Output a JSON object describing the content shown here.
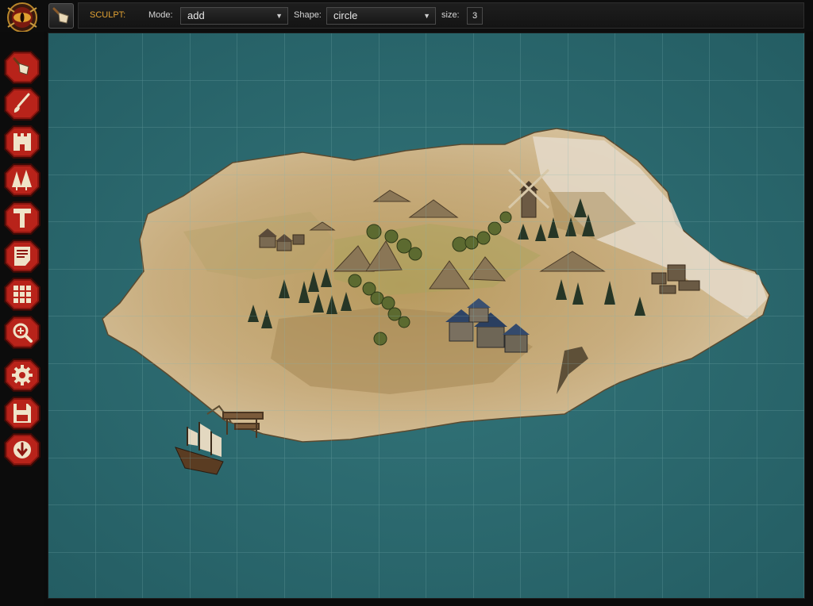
{
  "toolbar": {
    "active_tool_icon": "trowel-icon",
    "title": "SCULPT:",
    "mode_label": "Mode:",
    "mode_value": "add",
    "shape_label": "Shape:",
    "shape_value": "circle",
    "size_label": "size:",
    "size_value": "3"
  },
  "sidebar": {
    "tools": [
      {
        "name": "sculpt-tool",
        "icon": "trowel-icon"
      },
      {
        "name": "paint-tool",
        "icon": "brush-icon"
      },
      {
        "name": "buildings-tool",
        "icon": "castle-icon"
      },
      {
        "name": "trees-tool",
        "icon": "pine-trees-icon"
      },
      {
        "name": "text-tool",
        "icon": "letter-t-icon"
      },
      {
        "name": "notes-tool",
        "icon": "note-icon"
      },
      {
        "name": "grid-tool",
        "icon": "grid-icon"
      },
      {
        "name": "zoom-tool",
        "icon": "magnifier-icon"
      },
      {
        "name": "settings-tool",
        "icon": "gear-icon"
      },
      {
        "name": "save-tool",
        "icon": "floppy-disk-icon"
      },
      {
        "name": "download-tool",
        "icon": "download-icon"
      }
    ]
  },
  "colors": {
    "accent": "#e2a233",
    "button_red": "#a51b12",
    "sea": "#2c6a70",
    "grid": "#6aa3a6",
    "sand": "#c8ac80"
  }
}
